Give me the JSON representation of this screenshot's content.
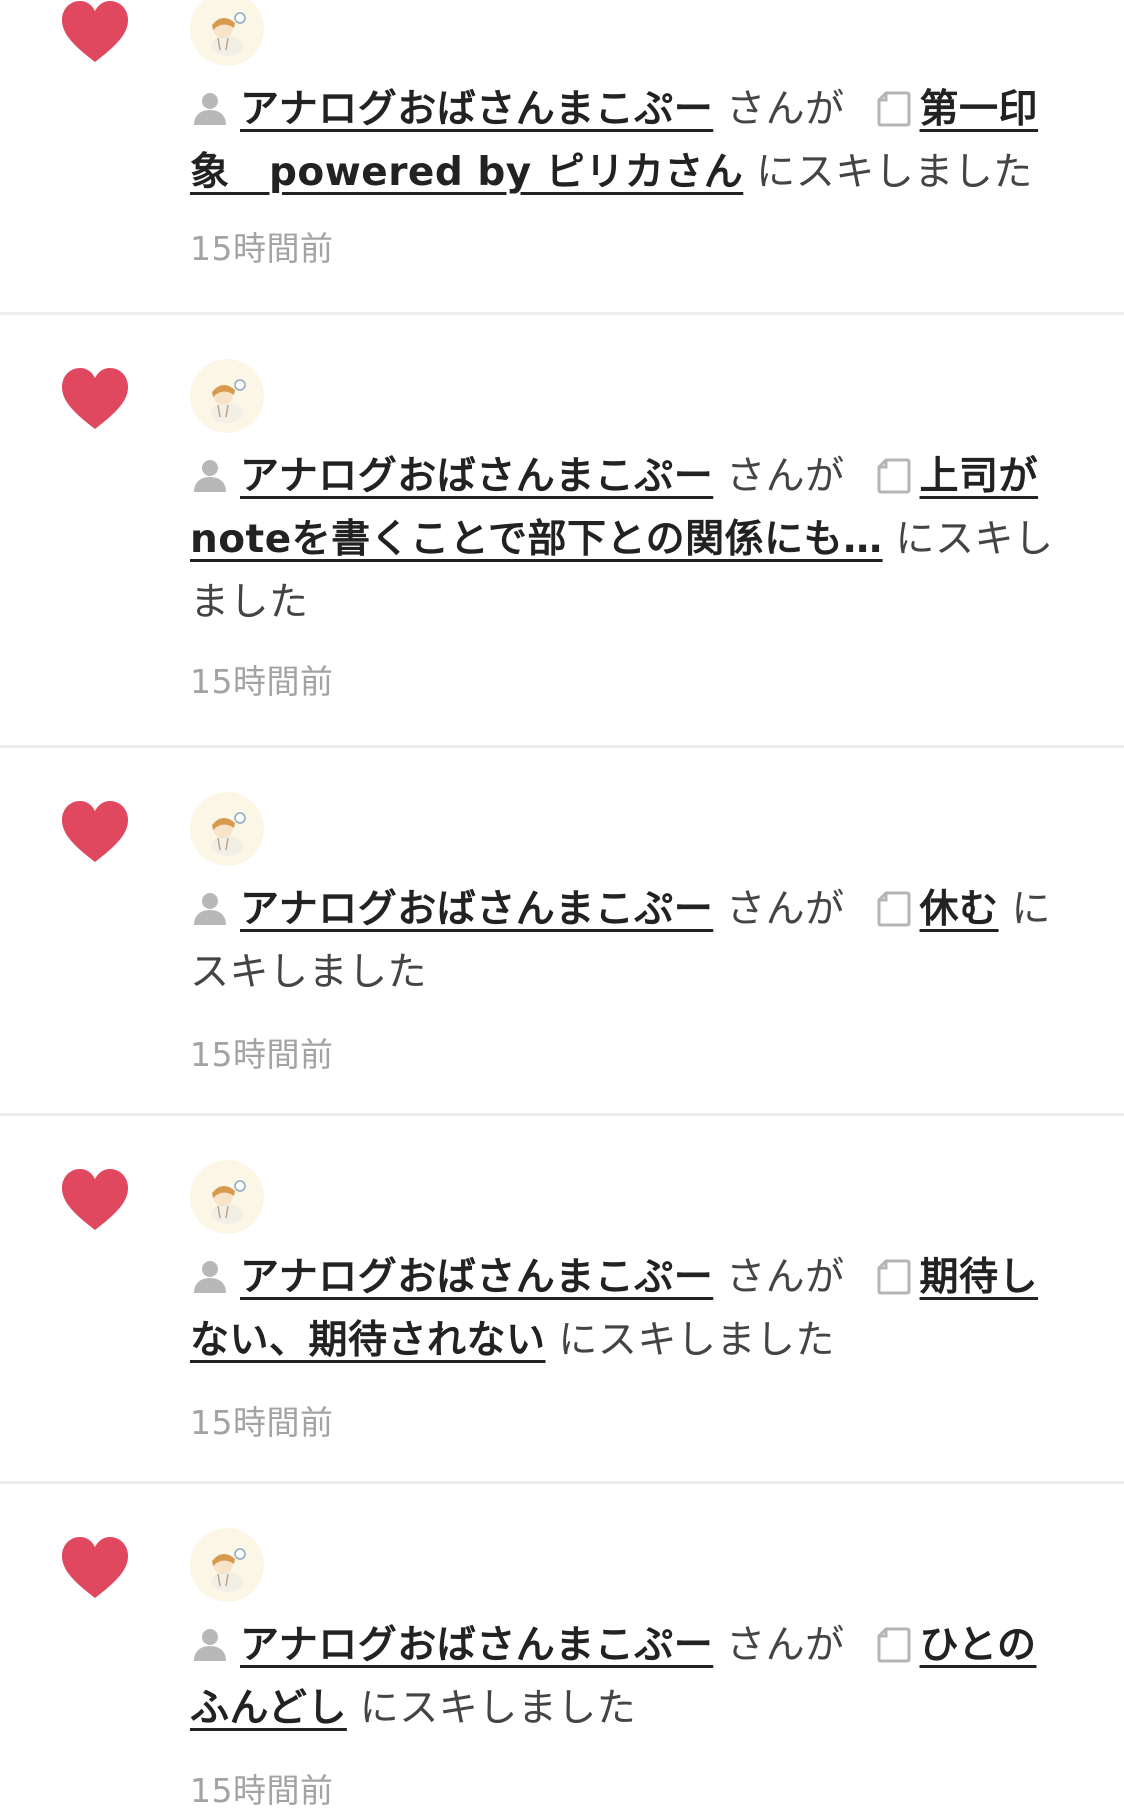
{
  "items": [
    {
      "user_name": "アナログおばさんまこぷー",
      "connector": " さんが ",
      "article_title": "第一印象　powered by ピリカさん",
      "suffix": " にスキしました",
      "time": "15時間前"
    },
    {
      "user_name": "アナログおばさんまこぷー",
      "connector": " さんが ",
      "article_title": "上司がnoteを書くことで部下との関係にも…",
      "suffix": " にスキしました",
      "time": "15時間前"
    },
    {
      "user_name": "アナログおばさんまこぷー",
      "connector": " さんが ",
      "article_title": "休む",
      "suffix": " にスキしました",
      "time": "15時間前"
    },
    {
      "user_name": "アナログおばさんまこぷー",
      "connector": " さんが ",
      "article_title": "期待しない、期待されない",
      "suffix": " にスキしました",
      "time": "15時間前"
    },
    {
      "user_name": "アナログおばさんまこぷー",
      "connector": " さんが ",
      "article_title": "ひとのふんどし",
      "suffix": " にスキしました",
      "time": "15時間前"
    }
  ],
  "icons": {
    "like": "heart-icon",
    "user": "user-icon",
    "note": "note-icon"
  },
  "colors": {
    "heart": "#e0485f",
    "time": "#a3a3a3",
    "divider": "#ececec"
  }
}
